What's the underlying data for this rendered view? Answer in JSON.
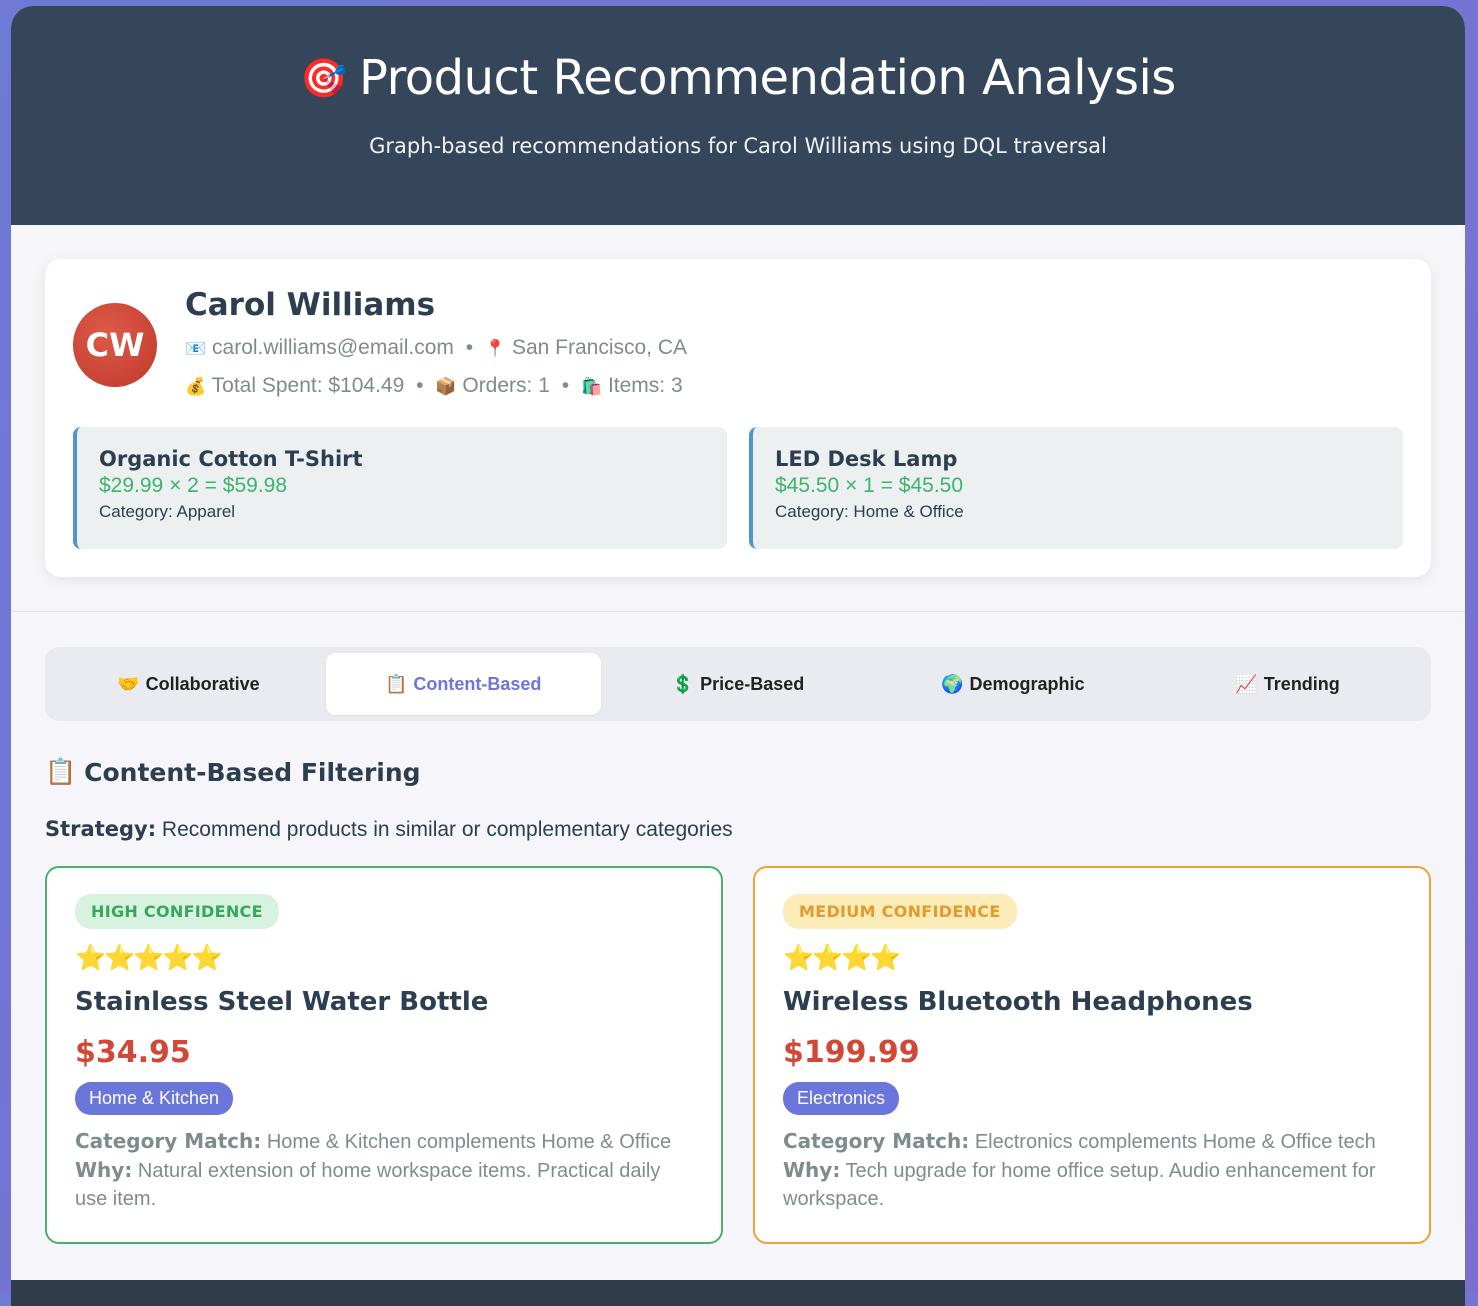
{
  "header": {
    "title": "Product Recommendation Analysis",
    "subtitle": "Graph-based recommendations for Carol Williams using DQL traversal",
    "title_icon": "🎯"
  },
  "profile": {
    "initials": "CW",
    "name": "Carol Williams",
    "email_icon": "📧",
    "email": "carol.williams@email.com",
    "location_icon": "📍",
    "location": "San Francisco, CA",
    "spent_icon": "💰",
    "total_spent": "Total Spent: $104.49",
    "orders_icon": "📦",
    "orders": "Orders: 1",
    "items_icon": "🛍️",
    "items": "Items: 3",
    "avatar_color": "#c0392b"
  },
  "purchases": [
    {
      "name": "Organic Cotton T-Shirt",
      "price_line": "$29.99 × 2 = $59.98",
      "category": "Category: Apparel"
    },
    {
      "name": "LED Desk Lamp",
      "price_line": "$45.50 × 1 = $45.50",
      "category": "Category: Home & Office"
    }
  ],
  "tabs": [
    {
      "icon": "🤝",
      "label": "Collaborative",
      "active": false
    },
    {
      "icon": "📋",
      "label": "Content-Based",
      "active": true
    },
    {
      "icon": "💲",
      "label": "Price-Based",
      "active": false
    },
    {
      "icon": "🌍",
      "label": "Demographic",
      "active": false
    },
    {
      "icon": "📈",
      "label": "Trending",
      "active": false
    }
  ],
  "section": {
    "icon": "📋",
    "title": "Content-Based Filtering",
    "strategy_label": "Strategy:",
    "strategy_text": " Recommend products in similar or complementary categories"
  },
  "recommendations": [
    {
      "confidence": "HIGH CONFIDENCE",
      "stars": "⭐⭐⭐⭐⭐",
      "rating": 5,
      "name": "Stainless Steel Water Bottle",
      "price": "$34.95",
      "category": "Home & Kitchen",
      "match_label": "Category Match:",
      "match_text": " Home & Kitchen complements Home & Office",
      "why_label": "Why:",
      "why_text": " Natural extension of home workspace items. Practical daily use item."
    },
    {
      "confidence": "MEDIUM CONFIDENCE",
      "stars": "⭐⭐⭐⭐",
      "rating": 4,
      "name": "Wireless Bluetooth Headphones",
      "price": "$199.99",
      "category": "Electronics",
      "match_label": "Category Match:",
      "match_text": " Electronics complements Home & Office tech",
      "why_label": "Why:",
      "why_text": " Tech upgrade for home office setup. Audio enhancement for workspace."
    }
  ],
  "colors": {
    "header_bg": "#35465a",
    "accent": "#6a76d9",
    "price": "#d14836",
    "high": "#4caf6b",
    "medium": "#eaa23d"
  }
}
